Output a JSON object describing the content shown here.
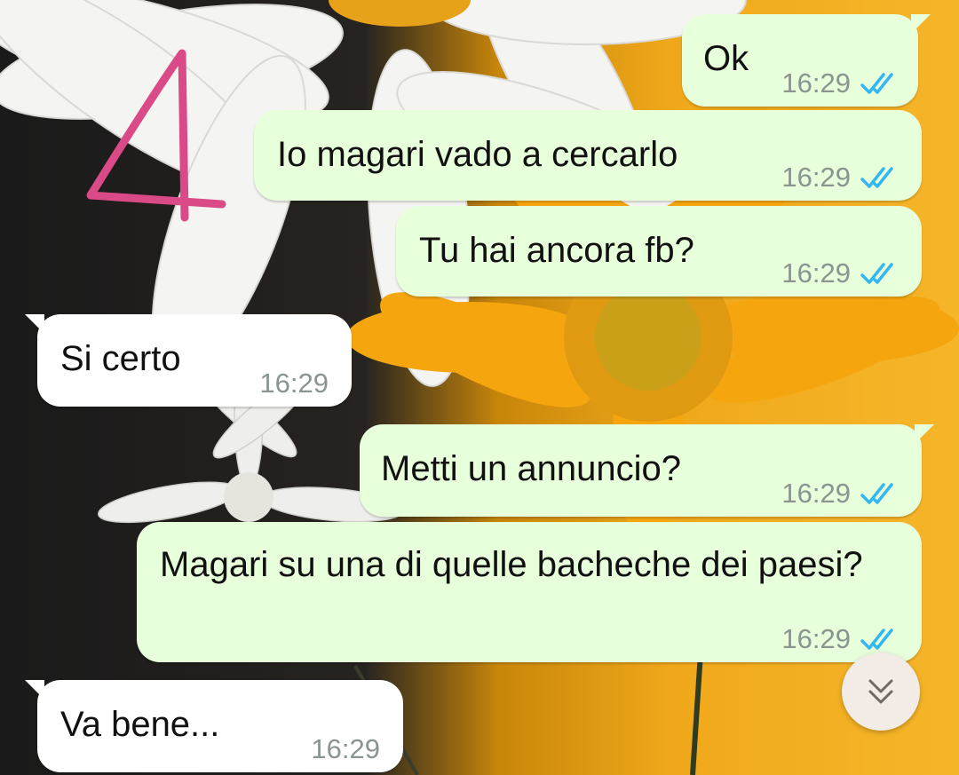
{
  "chat": {
    "messages": [
      {
        "direction": "outgoing",
        "text": "Ok",
        "time": "16:29",
        "status": "read"
      },
      {
        "direction": "outgoing",
        "text": "Io magari vado a cercarlo",
        "time": "16:29",
        "status": "read"
      },
      {
        "direction": "outgoing",
        "text": "Tu hai ancora fb?",
        "time": "16:29",
        "status": "read"
      },
      {
        "direction": "incoming",
        "text": "Si certo",
        "time": "16:29"
      },
      {
        "direction": "outgoing",
        "text": "Metti un annuncio?",
        "time": "16:29",
        "status": "read"
      },
      {
        "direction": "outgoing",
        "text": "Magari su una di quelle bacheche dei paesi?",
        "time": "16:29",
        "status": "read"
      },
      {
        "direction": "incoming",
        "text": "Va bene...",
        "time": "16:29"
      }
    ]
  },
  "annotation": {
    "text": "4",
    "color": "#d94a86"
  },
  "icons": {
    "read_ticks": "double-check-icon",
    "scroll": "chevron-double-down-icon"
  },
  "colors": {
    "outgoing_bubble": "#e7ffdb",
    "incoming_bubble": "#ffffff",
    "read_tick": "#34b7f1",
    "timestamp": "#8a9590"
  }
}
